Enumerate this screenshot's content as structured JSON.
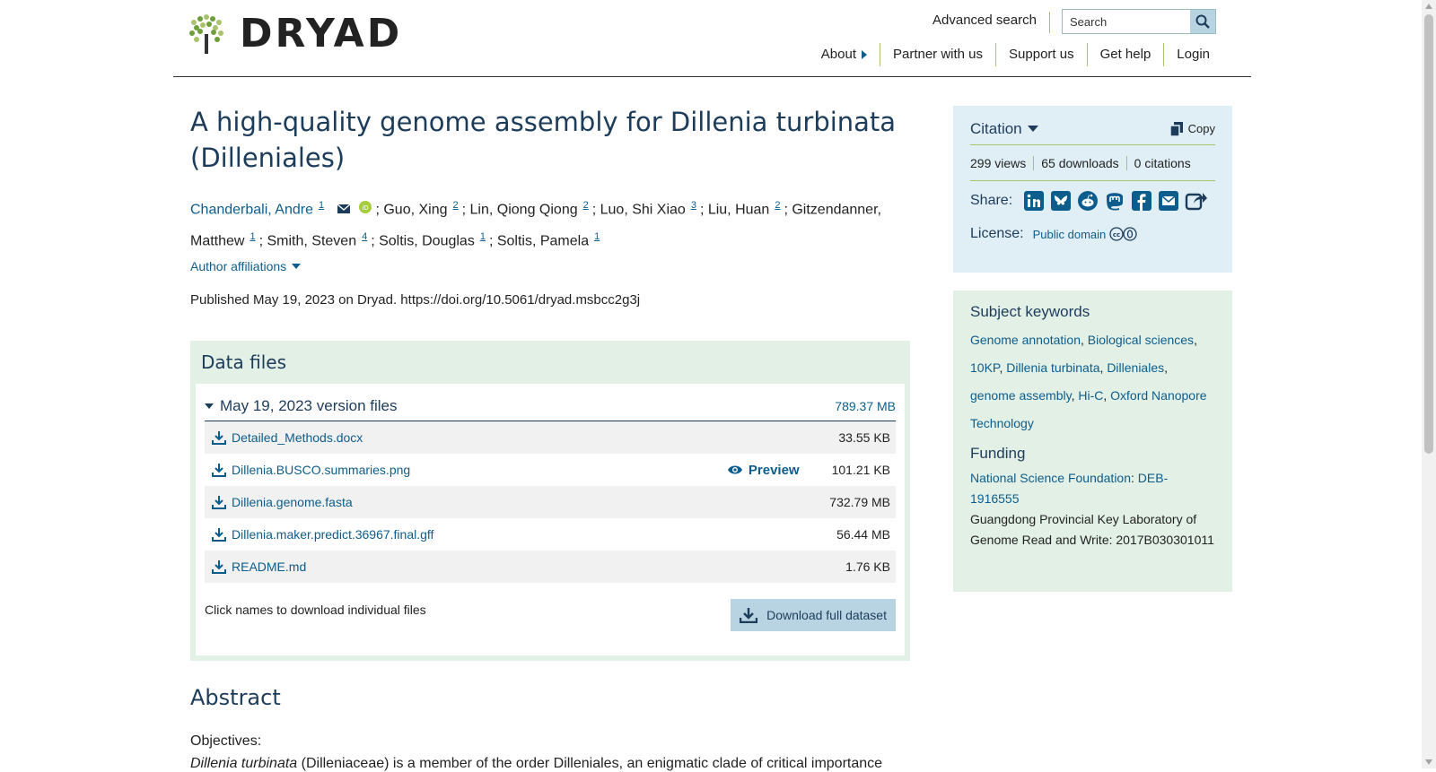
{
  "header": {
    "logo_text": "DRYAD",
    "advanced_search": "Advanced search",
    "search_placeholder": "Search",
    "nav": [
      "About",
      "Partner with us",
      "Support us",
      "Get help",
      "Login"
    ]
  },
  "dataset": {
    "title": "A high-quality genome assembly for Dillenia turbinata (Dilleniales)",
    "authors": [
      {
        "name": "Chanderbali, Andre",
        "aff": "1",
        "link": true
      },
      {
        "name": "Guo, Xing",
        "aff": "2"
      },
      {
        "name": "Lin, Qiong Qiong",
        "aff": "2"
      },
      {
        "name": "Luo, Shi Xiao",
        "aff": "3"
      },
      {
        "name": "Liu, Huan",
        "aff": "2"
      },
      {
        "name": "Gitzendanner, Matthew",
        "aff": "1"
      },
      {
        "name": "Smith, Steven",
        "aff": "4"
      },
      {
        "name": "Soltis, Douglas",
        "aff": "1"
      },
      {
        "name": "Soltis, Pamela",
        "aff": "1"
      }
    ],
    "author_affiliations": "Author affiliations",
    "published": "Published May 19, 2023 on Dryad. https://doi.org/10.5061/dryad.msbcc2g3j"
  },
  "data_files": {
    "heading": "Data files",
    "version_label": "May 19, 2023 version files",
    "version_size": "789.37 MB",
    "files": [
      {
        "name": "Detailed_Methods.docx",
        "size": "33.55 KB"
      },
      {
        "name": "Dillenia.BUSCO.summaries.png",
        "size": "101.21 KB",
        "preview": "Preview"
      },
      {
        "name": "Dillenia.genome.fasta",
        "size": "732.79 MB"
      },
      {
        "name": "Dillenia.maker.predict.36967.final.gff",
        "size": "56.44 MB"
      },
      {
        "name": "README.md",
        "size": "1.76 KB"
      }
    ],
    "note": "Click names to download individual files",
    "download_full": "Download full dataset"
  },
  "abstract": {
    "heading": "Abstract",
    "objectives": "Objectives:",
    "text_italic": "Dillenia turbinata",
    "text_rest": " (Dilleniaceae) is a member of the order Dilleniales, an enigmatic clade of critical importance"
  },
  "sidebar": {
    "citation_label": "Citation",
    "copy_label": "Copy",
    "views": "299 views",
    "downloads": "65 downloads",
    "citations": "0 citations",
    "share_label": "Share:",
    "license_label": "License:",
    "license_value": "Public domain",
    "keywords_heading": "Subject keywords",
    "keywords": [
      "Genome annotation",
      "Biological sciences",
      "10KP",
      "Dillenia turbinata",
      "Dilleniales",
      "genome assembly",
      "Hi-C",
      "Oxford Nanopore Technology"
    ],
    "funding_heading": "Funding",
    "funding_org": "National Science Foundation",
    "funding_grant": "DEB-1916555",
    "funding_other": "Guangdong Provincial Key Laboratory of Genome Read and Write: 2017B030301011"
  },
  "colors": {
    "accent": "#0d5d8c",
    "heading": "#1d3c5a",
    "green_divider": "#a9c36b",
    "citation_bg": "#e0eff6",
    "files_bg": "#e3f0e6"
  }
}
